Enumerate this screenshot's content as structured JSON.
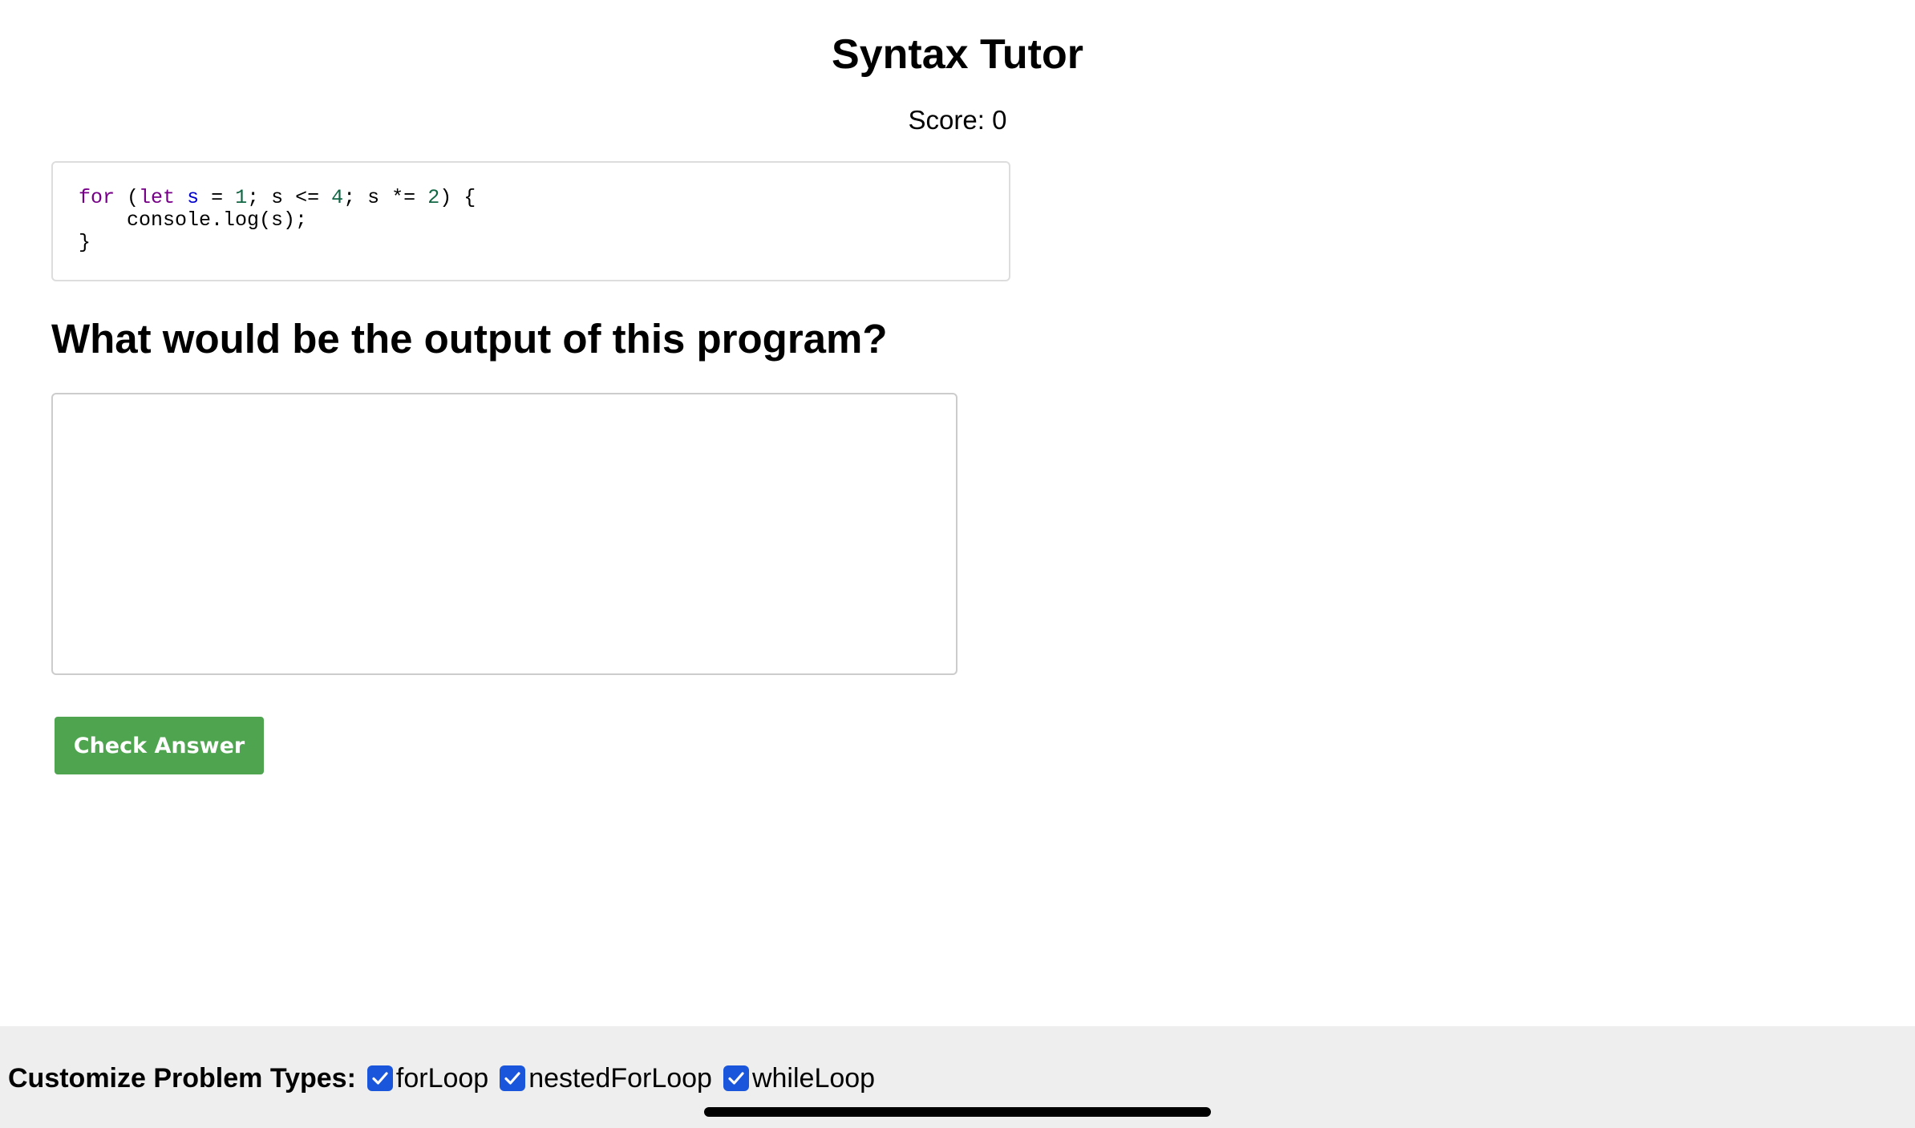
{
  "app": {
    "title": "Syntax Tutor",
    "score_text": "Score: 0"
  },
  "code": {
    "line1": {
      "kw_for": "for",
      "p1": " (",
      "kw_let": "let",
      "sp1": " ",
      "var_s": "s",
      "p2": " = ",
      "num1": "1",
      "p3": "; s <= ",
      "num2": "4",
      "p4": "; s *= ",
      "num3": "2",
      "p5": ") {"
    },
    "line2": "    console.log(s);",
    "line3": "}"
  },
  "question": {
    "text": "What would be the output of this program?"
  },
  "answer": {
    "value": "",
    "placeholder": ""
  },
  "actions": {
    "check_label": "Check Answer"
  },
  "footer": {
    "label": "Customize Problem Types:",
    "options": [
      {
        "label": "forLoop",
        "checked": true
      },
      {
        "label": "nestedForLoop",
        "checked": true
      },
      {
        "label": "whileLoop",
        "checked": true
      }
    ]
  },
  "colors": {
    "button_bg": "#4fa450",
    "checkbox_bg": "#1a56db",
    "footer_bg": "#eeeeee",
    "keyword": "#770088",
    "variable": "#0000cc",
    "number": "#116644"
  }
}
